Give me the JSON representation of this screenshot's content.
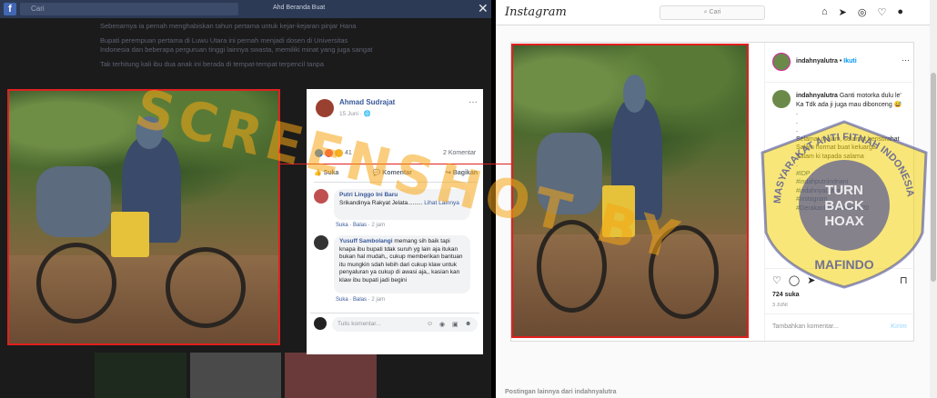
{
  "facebook": {
    "search_placeholder": "Cari",
    "top_links": "Ahd   Beranda   Buat",
    "bg_paragraphs": [
      "Sebenarnya ia pernah menghabiskan tahun pertama untuk kejar-kejaran pinjar Hana",
      "Bupati perempuan pertama di Luwu Utara ini pernah menjadi dosen di Universitas Indonesia dan beberapa perguruan tinggi lainnya swasta, memiliki minat yang juga sangat",
      "Tak terhitung kali ibu dua anak ini berada di tempat-tempat terpencil tanpa"
    ],
    "post": {
      "author": "Ahmad Sudrajat",
      "date": "15 Juni ·",
      "reaction_count": "41",
      "comment_count": "2 Komentar"
    },
    "actions": {
      "like": "Suka",
      "comment": "Komentar",
      "share": "Bagikan"
    },
    "comments": [
      {
        "name": "Putri Linggo Ini Baru",
        "text": "Srikandinya Rakyat Jelata.........",
        "see_more": "Lihat Lainnya",
        "like": "Suka",
        "reply": "Balas",
        "time": "2 jam"
      },
      {
        "name": "Yusuff Sambolangi",
        "text": "memang sih baik tapi knapa ibu bupati tdak suruh yg lain aja itukan bukan hal mudah,, cukup memberikan bantuan itu mungkin sdah lebih dari cukup klaw untuk penyaluran ya cukup di awasi aja,, kasian kan klaw ibu bupati jadi begini",
        "like": "Suka",
        "reply": "Balas",
        "time": "2 jam"
      }
    ],
    "write_placeholder": "Tulis komentar..."
  },
  "instagram": {
    "logo": "Instagram",
    "search_placeholder": "Cari",
    "username": "indahnyalutra",
    "follow": "Ikuti",
    "caption_intro": "Ganti motorka dulu le' Ka Tdk ada ji juga mau dibonceng",
    "caption_body": "Selamat malam, selamat beristirahat\nSalam hormat buat keluarga\nSalam ki tapada salama",
    "hashtags": "#IDP\n#indahputriindriani\n#indahnyaLutra\n#instagram\n#GerakanLuwuUtara2020",
    "likes": "724 suka",
    "date": "3 JUNI",
    "add_comment": "Tambahkan komentar...",
    "post_button": "Kirim",
    "more_posts": "Postingan lainnya dari indahnyalutra"
  },
  "overlay": {
    "watermark": "SCREENSHOT BY",
    "badge_ring": "MASYARAKAT ANTI FITNAH INDONESIA",
    "badge_inner": [
      "TURN",
      "BACK",
      "HOAX"
    ],
    "badge_bottom": "MAFINDO"
  },
  "colors": {
    "highlight_red": "#e02020",
    "facebook_blue": "#385898",
    "instagram_link": "#0095f6",
    "watermark_orange": "#f5a514",
    "badge_blue": "#3b3f9a",
    "badge_yellow": "#f2d40a"
  }
}
